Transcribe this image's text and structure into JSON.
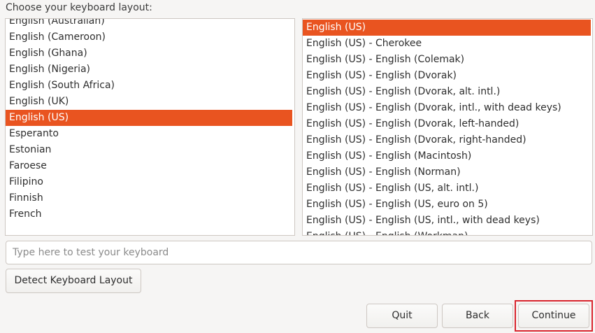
{
  "prompt": "Choose your keyboard layout:",
  "languages": {
    "items": [
      {
        "label": "English (Australian)",
        "selected": false
      },
      {
        "label": "English (Cameroon)",
        "selected": false
      },
      {
        "label": "English (Ghana)",
        "selected": false
      },
      {
        "label": "English (Nigeria)",
        "selected": false
      },
      {
        "label": "English (South Africa)",
        "selected": false
      },
      {
        "label": "English (UK)",
        "selected": false
      },
      {
        "label": "English (US)",
        "selected": true
      },
      {
        "label": "Esperanto",
        "selected": false
      },
      {
        "label": "Estonian",
        "selected": false
      },
      {
        "label": "Faroese",
        "selected": false
      },
      {
        "label": "Filipino",
        "selected": false
      },
      {
        "label": "Finnish",
        "selected": false
      },
      {
        "label": "French",
        "selected": false
      }
    ]
  },
  "variants": {
    "items": [
      {
        "label": "English (US)",
        "selected": true
      },
      {
        "label": "English (US) - Cherokee",
        "selected": false
      },
      {
        "label": "English (US) - English (Colemak)",
        "selected": false
      },
      {
        "label": "English (US) - English (Dvorak)",
        "selected": false
      },
      {
        "label": "English (US) - English (Dvorak, alt. intl.)",
        "selected": false
      },
      {
        "label": "English (US) - English (Dvorak, intl., with dead keys)",
        "selected": false
      },
      {
        "label": "English (US) - English (Dvorak, left-handed)",
        "selected": false
      },
      {
        "label": "English (US) - English (Dvorak, right-handed)",
        "selected": false
      },
      {
        "label": "English (US) - English (Macintosh)",
        "selected": false
      },
      {
        "label": "English (US) - English (Norman)",
        "selected": false
      },
      {
        "label": "English (US) - English (US, alt. intl.)",
        "selected": false
      },
      {
        "label": "English (US) - English (US, euro on 5)",
        "selected": false
      },
      {
        "label": "English (US) - English (US, intl., with dead keys)",
        "selected": false
      },
      {
        "label": "English (US) - English (Workman)",
        "selected": false
      }
    ]
  },
  "test_input": {
    "placeholder": "Type here to test your keyboard",
    "value": ""
  },
  "buttons": {
    "detect": "Detect Keyboard Layout",
    "quit": "Quit",
    "back": "Back",
    "continue": "Continue"
  },
  "colors": {
    "selection": "#e95420",
    "focus_highlight": "#d9252e"
  }
}
